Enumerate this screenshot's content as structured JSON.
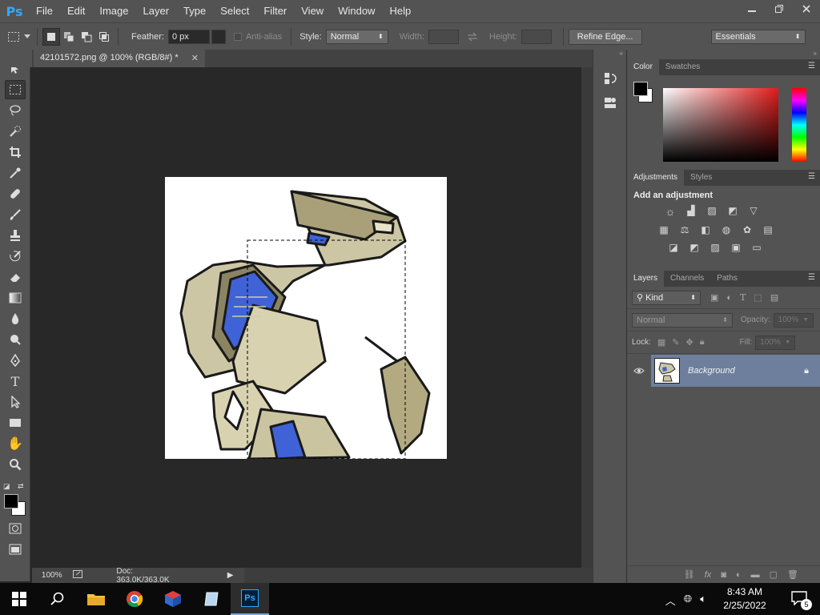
{
  "app": {
    "logo": "Ps"
  },
  "menu": [
    "File",
    "Edit",
    "Image",
    "Layer",
    "Type",
    "Select",
    "Filter",
    "View",
    "Window",
    "Help"
  ],
  "window_controls": {
    "minimize": "minimize-icon",
    "restore": "restore-icon",
    "close": "close-icon"
  },
  "options": {
    "feather_label": "Feather:",
    "feather_value": "0 px",
    "antialias_label": "Anti-alias",
    "style_label": "Style:",
    "style_value": "Normal",
    "width_label": "Width:",
    "height_label": "Height:",
    "refine_edge": "Refine Edge...",
    "workspace": "Essentials"
  },
  "document": {
    "tab_title": "42101572.png @ 100% (RGB/8#) *",
    "zoom": "100%",
    "doc_info": "Doc: 363.0K/363.0K"
  },
  "color_panel": {
    "tabs": [
      "Color",
      "Swatches"
    ]
  },
  "adjustments_panel": {
    "tabs": [
      "Adjustments",
      "Styles"
    ],
    "heading": "Add an adjustment"
  },
  "layers_panel": {
    "tabs": [
      "Layers",
      "Channels",
      "Paths"
    ],
    "filter_kind": "Kind",
    "blend_mode": "Normal",
    "opacity_label": "Opacity:",
    "opacity_value": "100%",
    "lock_label": "Lock:",
    "fill_label": "Fill:",
    "fill_value": "100%",
    "layers": [
      {
        "name": "Background",
        "visible": true,
        "locked": true
      }
    ]
  },
  "taskbar": {
    "time": "8:43 AM",
    "date": "2/25/2022",
    "notifications": "5"
  },
  "colors": {
    "accent": "#31a8ff",
    "panel": "#535353",
    "canvas_bg": "#282828",
    "selected_layer": "#6d7f9c"
  }
}
